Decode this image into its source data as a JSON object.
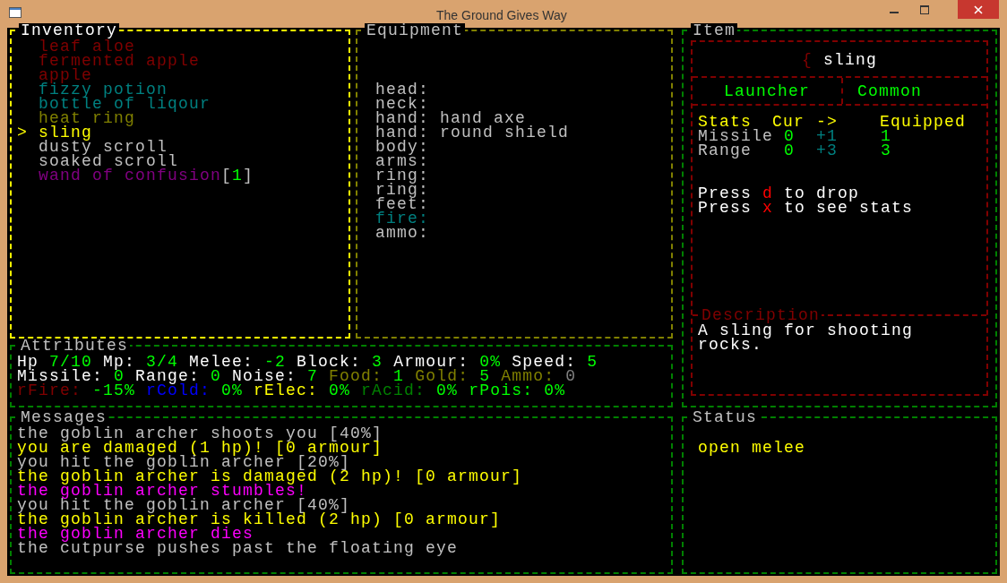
{
  "window": {
    "title": "The Ground Gives Way"
  },
  "inventory": {
    "title": "Inventory",
    "cursor": ">",
    "items": [
      {
        "name": "leaf aloe",
        "color": "#800000",
        "selected": false
      },
      {
        "name": "fermented apple",
        "color": "#800000",
        "selected": false
      },
      {
        "name": "apple",
        "color": "#800000",
        "selected": false
      },
      {
        "name": "fizzy potion",
        "color": "#008080",
        "selected": false
      },
      {
        "name": "bottle of liqour",
        "color": "#008080",
        "selected": false
      },
      {
        "name": "heat ring",
        "color": "#808000",
        "selected": false
      },
      {
        "name": "sling",
        "color": "#ffff00",
        "selected": true
      },
      {
        "name": "dusty scroll",
        "color": "#c0c0c0",
        "selected": false
      },
      {
        "name": "soaked scroll",
        "color": "#c0c0c0",
        "selected": false
      },
      {
        "name": "wand of confusion",
        "color": "#800080",
        "selected": false,
        "suffix": [
          {
            "text": "[",
            "color": "#c0c0c0"
          },
          {
            "text": "1",
            "color": "#00ff00"
          },
          {
            "text": "]",
            "color": "#c0c0c0"
          }
        ]
      }
    ]
  },
  "equipment": {
    "title": "Equipment",
    "slots": [
      {
        "slot": "head:",
        "color": "#c0c0c0"
      },
      {
        "slot": "neck:",
        "color": "#c0c0c0"
      },
      {
        "slot": "hand:",
        "color": "#c0c0c0",
        "item": "hand axe"
      },
      {
        "slot": "hand:",
        "color": "#c0c0c0",
        "item": "round shield"
      },
      {
        "slot": "body:",
        "color": "#c0c0c0"
      },
      {
        "slot": "arms:",
        "color": "#c0c0c0"
      },
      {
        "slot": "ring:",
        "color": "#c0c0c0"
      },
      {
        "slot": "ring:",
        "color": "#c0c0c0"
      },
      {
        "slot": "feet:",
        "color": "#c0c0c0"
      },
      {
        "slot": "fire:",
        "color": "#008080"
      },
      {
        "slot": "ammo:",
        "color": "#c0c0c0"
      }
    ]
  },
  "item": {
    "title": "Item",
    "glyph": "{",
    "name": "sling",
    "category": "Launcher",
    "rarity": "Common",
    "stats_header": [
      "Stats",
      "Cur",
      "->",
      "Equipped"
    ],
    "stats": [
      {
        "stat": "Missile",
        "cur": "0",
        "change": "+1",
        "equipped": "1"
      },
      {
        "stat": "Range",
        "cur": "0",
        "change": "+3",
        "equipped": "3"
      }
    ],
    "hints": [
      {
        "before": "Press",
        "key": "d",
        "after": "to drop"
      },
      {
        "before": "Press",
        "key": "x",
        "after": "to see stats"
      }
    ],
    "description": {
      "title": "Description",
      "text": "A sling for shooting rocks."
    }
  },
  "attributes": {
    "title": "Attributes",
    "lines": [
      [
        {
          "text": "Hp",
          "color": "#ffffff"
        },
        {
          "text": "7/10",
          "color": "#00ff00"
        },
        {
          "text": "Mp:",
          "color": "#ffffff"
        },
        {
          "text": "3/4",
          "color": "#00ff00"
        },
        {
          "text": "Melee:",
          "color": "#ffffff"
        },
        {
          "text": "-2",
          "color": "#00ff00"
        },
        {
          "text": "Block:",
          "color": "#ffffff"
        },
        {
          "text": "3",
          "color": "#00ff00"
        },
        {
          "text": "Armour:",
          "color": "#ffffff"
        },
        {
          "text": "0%",
          "color": "#00ff00"
        },
        {
          "text": "Speed:",
          "color": "#ffffff"
        },
        {
          "text": "5",
          "color": "#00ff00"
        }
      ],
      [
        {
          "text": "Missile:",
          "color": "#ffffff"
        },
        {
          "text": "0",
          "color": "#00ff00"
        },
        {
          "text": "Range:",
          "color": "#ffffff"
        },
        {
          "text": "0",
          "color": "#00ff00"
        },
        {
          "text": "Noise:",
          "color": "#ffffff"
        },
        {
          "text": "7",
          "color": "#00ff00"
        },
        {
          "text": "Food:",
          "color": "#808000"
        },
        {
          "text": "1",
          "color": "#00ff00"
        },
        {
          "text": "Gold:",
          "color": "#808000"
        },
        {
          "text": "5",
          "color": "#00ff00"
        },
        {
          "text": "Ammo:",
          "color": "#808000"
        },
        {
          "text": "0",
          "color": "#808080"
        }
      ],
      [
        {
          "text": "rFire:",
          "color": "#800000"
        },
        {
          "text": "-15%",
          "color": "#00ff00"
        },
        {
          "text": "rCold:",
          "color": "#0000ff"
        },
        {
          "text": "0%",
          "color": "#00ff00"
        },
        {
          "text": "rElec:",
          "color": "#ffff00"
        },
        {
          "text": "0%",
          "color": "#00ff00"
        },
        {
          "text": "rAcid:",
          "color": "#008000"
        },
        {
          "text": "0%",
          "color": "#00ff00"
        },
        {
          "text": "rPois:",
          "color": "#00ff00"
        },
        {
          "text": "0%",
          "color": "#00ff00"
        }
      ]
    ]
  },
  "messages": {
    "title": "Messages",
    "lines": [
      {
        "text": "the goblin archer shoots you [40%]",
        "color": "#c0c0c0"
      },
      {
        "text": "you are damaged (1 hp)! [0 armour]",
        "color": "#ffff00"
      },
      {
        "text": "you hit the goblin archer [20%]",
        "color": "#c0c0c0"
      },
      {
        "text": "the goblin archer is damaged (2 hp)! [0 armour]",
        "color": "#ffff00"
      },
      {
        "text": "the goblin archer stumbles!",
        "color": "#ff00ff"
      },
      {
        "text": "you hit the goblin archer [40%]",
        "color": "#c0c0c0"
      },
      {
        "text": "the goblin archer is killed (2 hp) [0 armour]",
        "color": "#ffff00"
      },
      {
        "text": "the goblin archer dies",
        "color": "#ff00ff"
      },
      {
        "text": "the cutpurse pushes past the floating eye",
        "color": "#c0c0c0"
      }
    ]
  },
  "status": {
    "title": "Status",
    "lines": [
      "open melee"
    ]
  }
}
